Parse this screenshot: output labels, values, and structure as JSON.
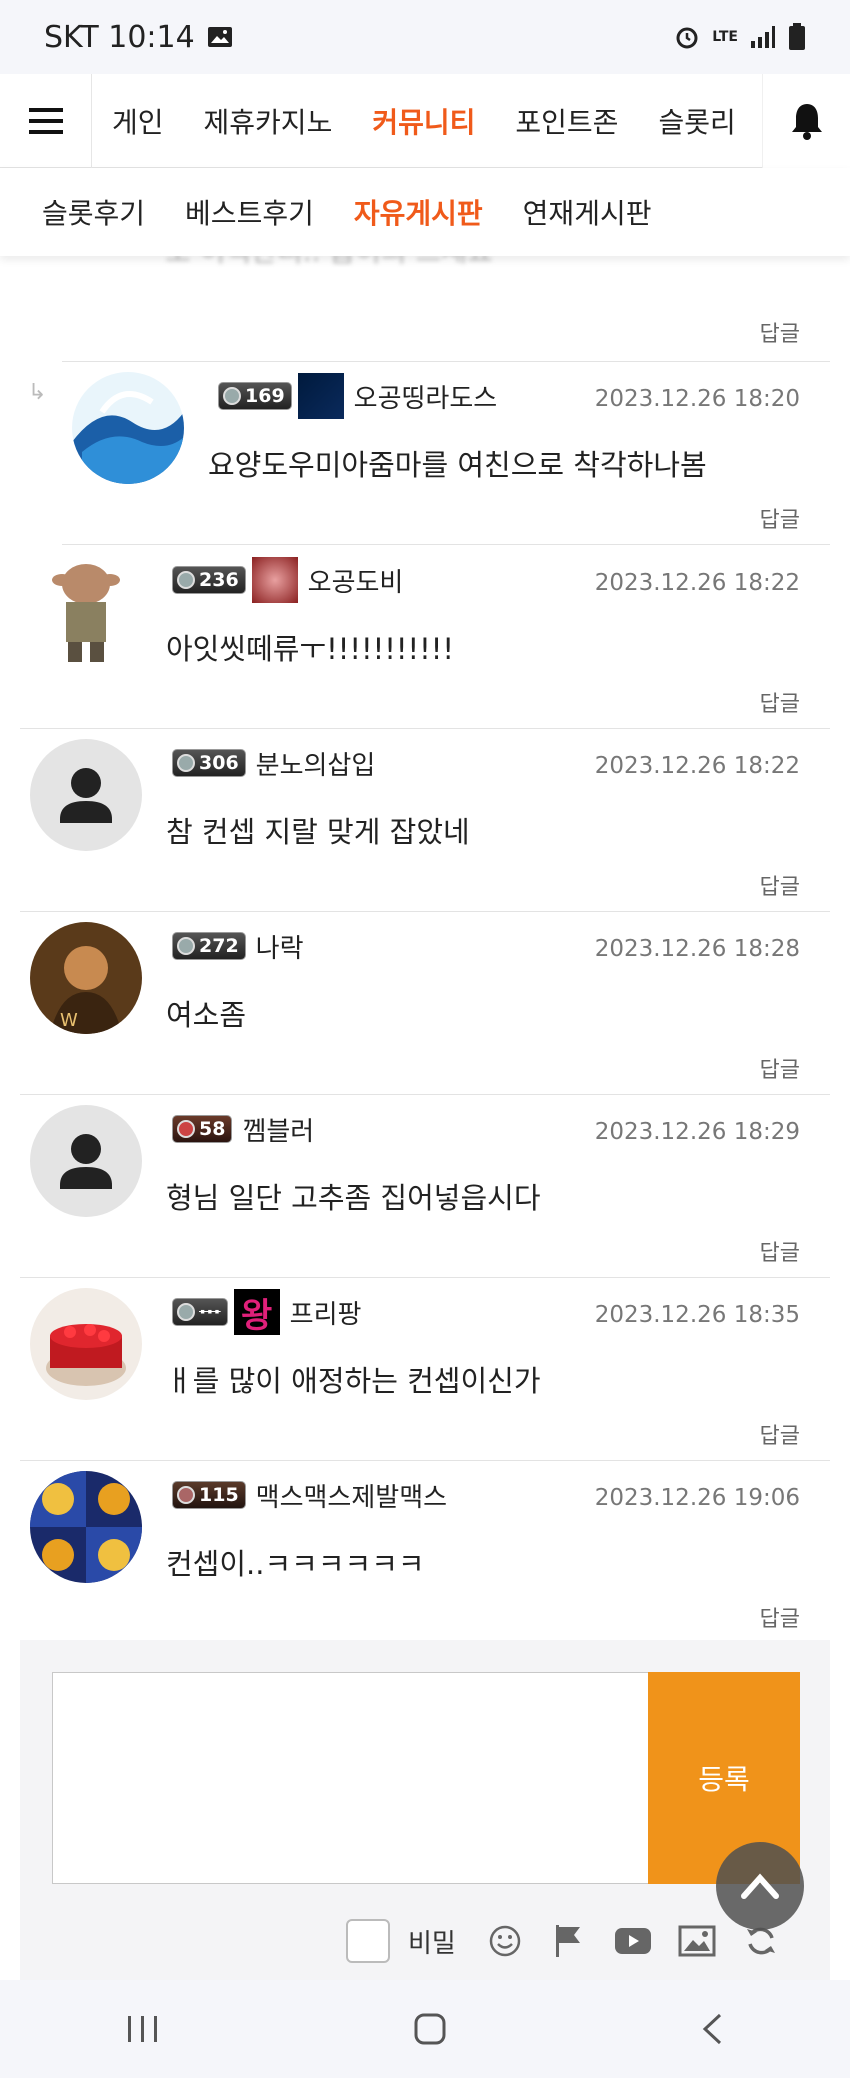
{
  "status": {
    "carrier_time": "SKT 10:14",
    "network": "LTE"
  },
  "nav": {
    "items": [
      "게인",
      "제휴카지노",
      "커뮤니티",
      "포인트존",
      "슬롯리"
    ],
    "active_index": 2
  },
  "subnav": {
    "items": [
      "슬롯후기",
      "베스트후기",
      "자유게시판",
      "연재게시판"
    ],
    "active_index": 2
  },
  "faded_text": "포 이력관리.. 몹이의 드세요",
  "reply_label": "답글",
  "comments": [
    {
      "level": "169",
      "nick": "오공띵라도스",
      "date": "2023.12.26 18:20",
      "text": "요양도우미아줌마를 여친으로 착각하나봄",
      "nested": true
    },
    {
      "level": "236",
      "nick": "오공도비",
      "date": "2023.12.26 18:22",
      "text": "아잇씻떼류ㅜ!!!!!!!!!!!"
    },
    {
      "level": "306",
      "nick": "분노의삽입",
      "date": "2023.12.26 18:22",
      "text": "참 컨셉 지랄 맞게 잡았네"
    },
    {
      "level": "272",
      "nick": "나락",
      "date": "2023.12.26 18:28",
      "text": "여소좀"
    },
    {
      "level": "58",
      "nick": "껨블러",
      "date": "2023.12.26 18:29",
      "text": "형님 일단 고추좀 집어넣읍시다"
    },
    {
      "level": "",
      "nick": "프리팡",
      "date": "2023.12.26 18:35",
      "text": "ㅐ를 많이 애정하는 컨셉이신가",
      "badge_text": "왕"
    },
    {
      "level": "115",
      "nick": "맥스맥스제발맥스",
      "date": "2023.12.26 19:06",
      "text": "컨셉이..ㅋㅋㅋㅋㅋㅋ"
    }
  ],
  "composer": {
    "submit_label": "등록",
    "secret_label": "비밀"
  },
  "colors": {
    "accent": "#f05a1a",
    "button": "#f0931a"
  }
}
